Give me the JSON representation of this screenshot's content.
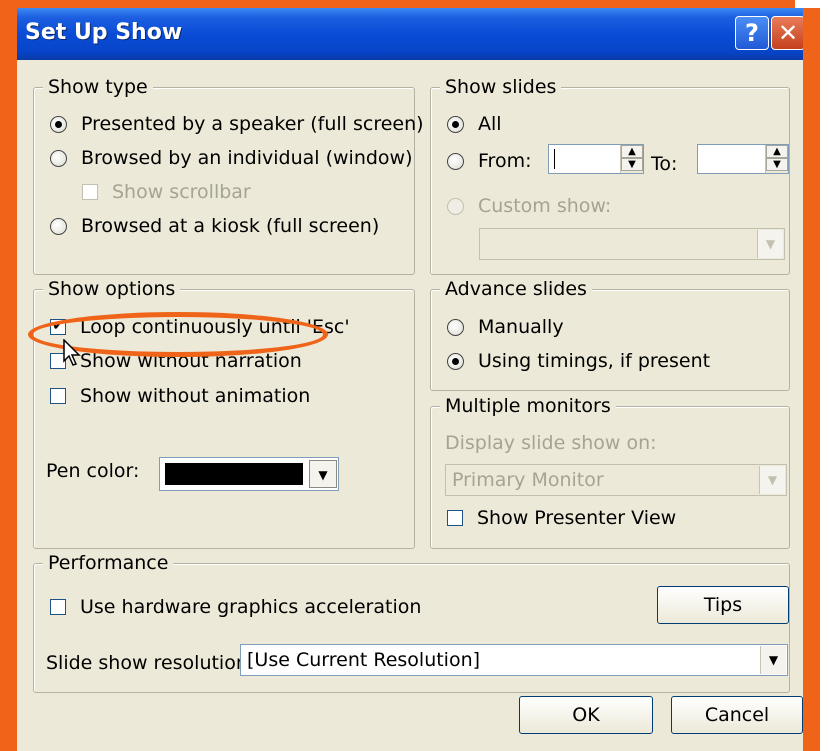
{
  "dialog": {
    "title": "Set Up Show"
  },
  "titlebar": {
    "help_glyph": "?",
    "close_glyph": "✕"
  },
  "show_type": {
    "legend": "Show type",
    "options": [
      "Presented by a speaker (full screen)",
      "Browsed by an individual (window)",
      "Browsed at a kiosk (full screen)"
    ],
    "selected": 0,
    "show_scrollbar_label": "Show scrollbar"
  },
  "show_slides": {
    "legend": "Show slides",
    "all_label": "All",
    "from_label": "From:",
    "to_label": "To:",
    "from_value": "",
    "to_value": "",
    "custom_show_label": "Custom show:",
    "custom_show_value": ""
  },
  "show_options": {
    "legend": "Show options",
    "loop_label": "Loop continuously until 'Esc'",
    "loop_checked": true,
    "no_narration_label": "Show without narration",
    "no_animation_label": "Show without animation",
    "pen_color_label": "Pen color:",
    "pen_color": "#000000"
  },
  "advance_slides": {
    "legend": "Advance slides",
    "manually_label": "Manually",
    "timings_label": "Using timings, if present",
    "selected": "timings"
  },
  "multiple_monitors": {
    "legend": "Multiple monitors",
    "display_on_label": "Display slide show on:",
    "monitor_value": "Primary Monitor",
    "presenter_view_label": "Show Presenter View"
  },
  "performance": {
    "legend": "Performance",
    "hw_accel_label": "Use hardware graphics acceleration",
    "tips_label": "Tips",
    "resolution_label": "Slide show resolution:",
    "resolution_value": "[Use Current Resolution]"
  },
  "footer": {
    "ok_label": "OK",
    "cancel_label": "Cancel"
  },
  "colors": {
    "highlight": "#ef6418",
    "titlebar": "#0a4cd6",
    "dialog_bg": "#ece9d8"
  }
}
